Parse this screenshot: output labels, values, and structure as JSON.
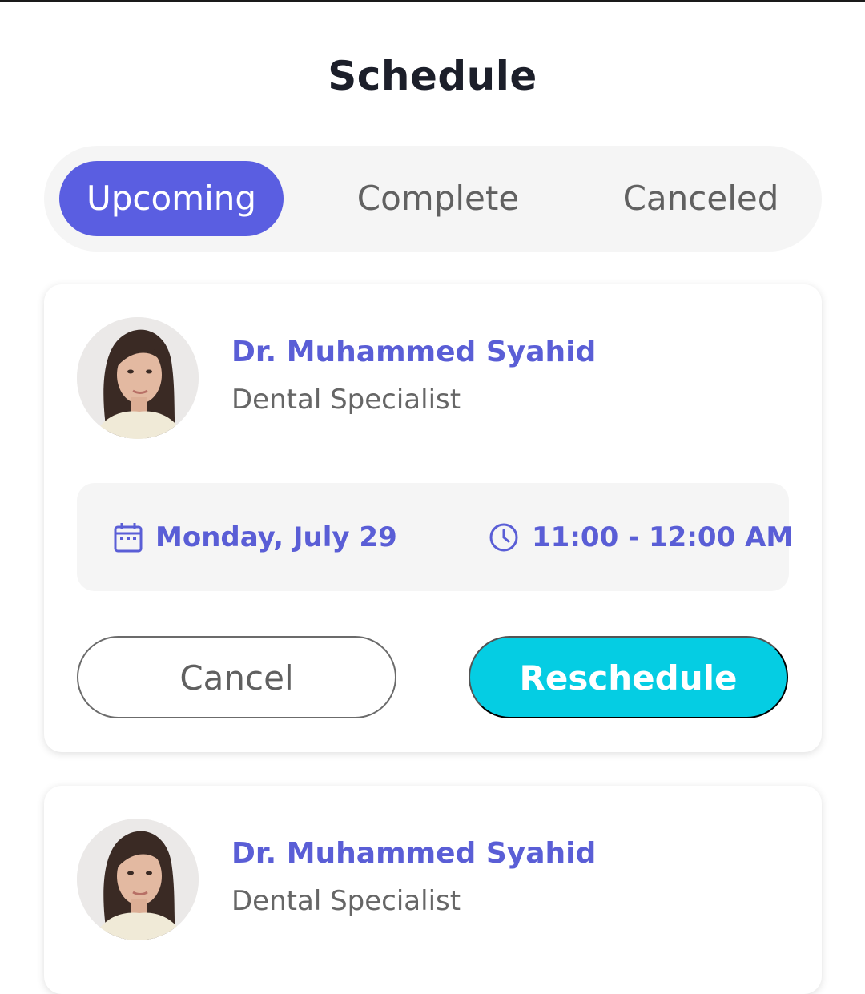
{
  "header": {
    "title": "Schedule"
  },
  "tabs": [
    {
      "label": "Upcoming",
      "active": true
    },
    {
      "label": "Complete",
      "active": false
    },
    {
      "label": "Canceled",
      "active": false
    }
  ],
  "appointments": [
    {
      "doctor_name": "Dr. Muhammed Syahid",
      "specialty": "Dental Specialist",
      "date": "Monday, July 29",
      "time": "11:00 - 12:00 AM",
      "cancel_label": "Cancel",
      "reschedule_label": "Reschedule"
    },
    {
      "doctor_name": "Dr. Muhammed Syahid",
      "specialty": "Dental Specialist"
    }
  ],
  "icons": {
    "date": "calendar-icon",
    "time": "clock-icon"
  },
  "colors": {
    "accent": "#5A5EE1",
    "doctor_text": "#5A5ED6",
    "reschedule": "#05CDE3",
    "tab_bg": "#F5F5F5"
  }
}
